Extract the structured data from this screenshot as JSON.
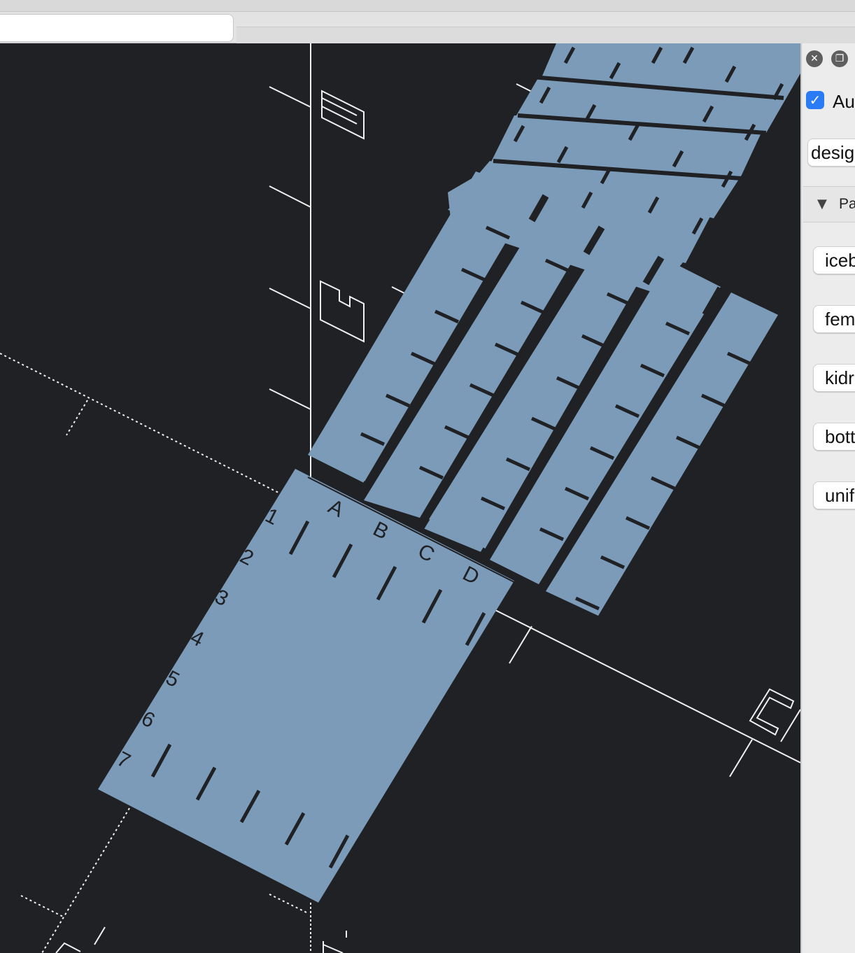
{
  "toolbar": {
    "active_tab_label": ""
  },
  "viewport": {
    "background": "#202124",
    "part_fill": "#7b9bb9",
    "ruler_row_labels": [
      "1",
      "2",
      "3",
      "4",
      "5",
      "6",
      "7"
    ],
    "ruler_column_labels": [
      "A",
      "B",
      "C",
      "D"
    ]
  },
  "panel": {
    "close_icon": "close-icon",
    "restore_icon": "restore-icon",
    "auto_checkbox": {
      "label": "Aut",
      "checked": true
    },
    "design_field": {
      "value": "desig"
    },
    "parameters_section": {
      "title": "Pa",
      "expanded": true
    },
    "preset_buttons": [
      "iceb",
      "fem",
      "kidr",
      "bott",
      "unif"
    ]
  }
}
